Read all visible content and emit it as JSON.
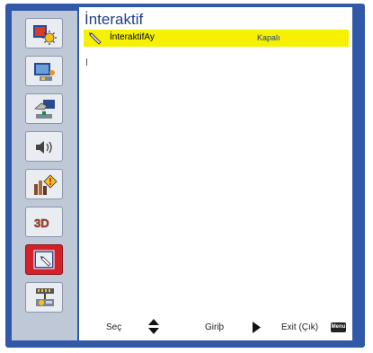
{
  "title": "İnteraktif",
  "row": {
    "label": "İnteraktifAy",
    "value": "Kapalı"
  },
  "footer": {
    "select_label": "Seç",
    "enter_label": "Giriþ",
    "exit_label": "Exit (Çık)",
    "menu_badge": "Menu"
  },
  "sidebar": {
    "items": [
      {
        "icon": "image-settings-icon",
        "active": false
      },
      {
        "icon": "screen-settings-icon",
        "active": false
      },
      {
        "icon": "setup-hand-icon",
        "active": false
      },
      {
        "icon": "audio-icon",
        "active": false
      },
      {
        "icon": "options-icon",
        "active": false
      },
      {
        "icon": "3d-icon",
        "active": false,
        "text": "3D"
      },
      {
        "icon": "interactive-icon",
        "active": true
      },
      {
        "icon": "network-icon",
        "active": false
      }
    ]
  },
  "colors": {
    "frame": "#3259a8",
    "sidebar": "#bfc8d6",
    "highlight_row": "#f5f100",
    "active_item": "#d3212c",
    "title_text": "#1f3f86"
  }
}
